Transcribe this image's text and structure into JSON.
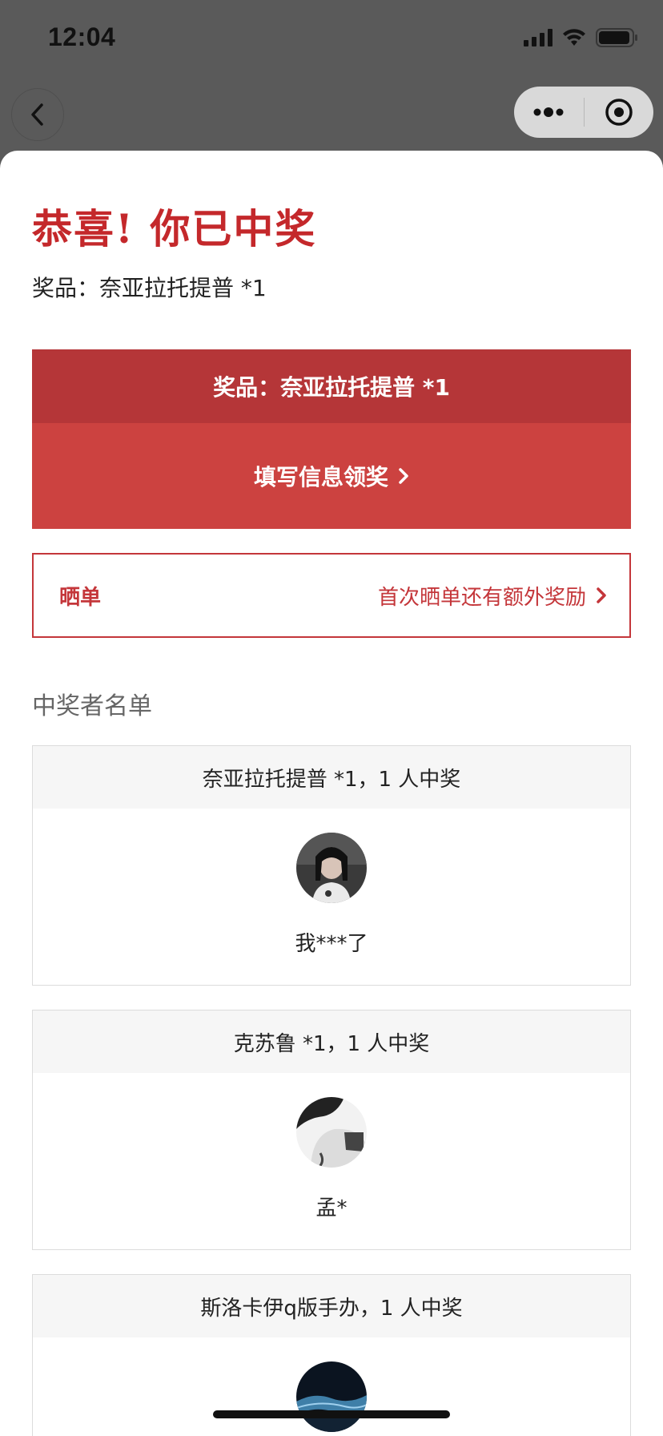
{
  "status": {
    "time": "12:04"
  },
  "nav": {
    "back_icon": "chevron-left-icon",
    "more_icon": "more-dots-icon",
    "target_icon": "target-icon"
  },
  "header": {
    "title": "恭喜! 你已中奖",
    "prize_line": "奖品：奈亚拉托提普 *1"
  },
  "prize_card": {
    "label": "奖品：奈亚拉托提普 *1",
    "claim_label": "填写信息领奖"
  },
  "share": {
    "title": "晒单",
    "note": "首次晒单还有额外奖励"
  },
  "winners": {
    "title": "中奖者名单",
    "items": [
      {
        "heading": "奈亚拉托提普 *1，1 人中奖",
        "name": "我***了"
      },
      {
        "heading": "克苏鲁 *1，1 人中奖",
        "name": "孟*"
      },
      {
        "heading": "斯洛卡伊q版手办，1 人中奖",
        "name": ""
      }
    ]
  },
  "colors": {
    "accent": "#c4282b",
    "prize_head_bg": "#b53638",
    "claim_bg": "#cc4240"
  }
}
